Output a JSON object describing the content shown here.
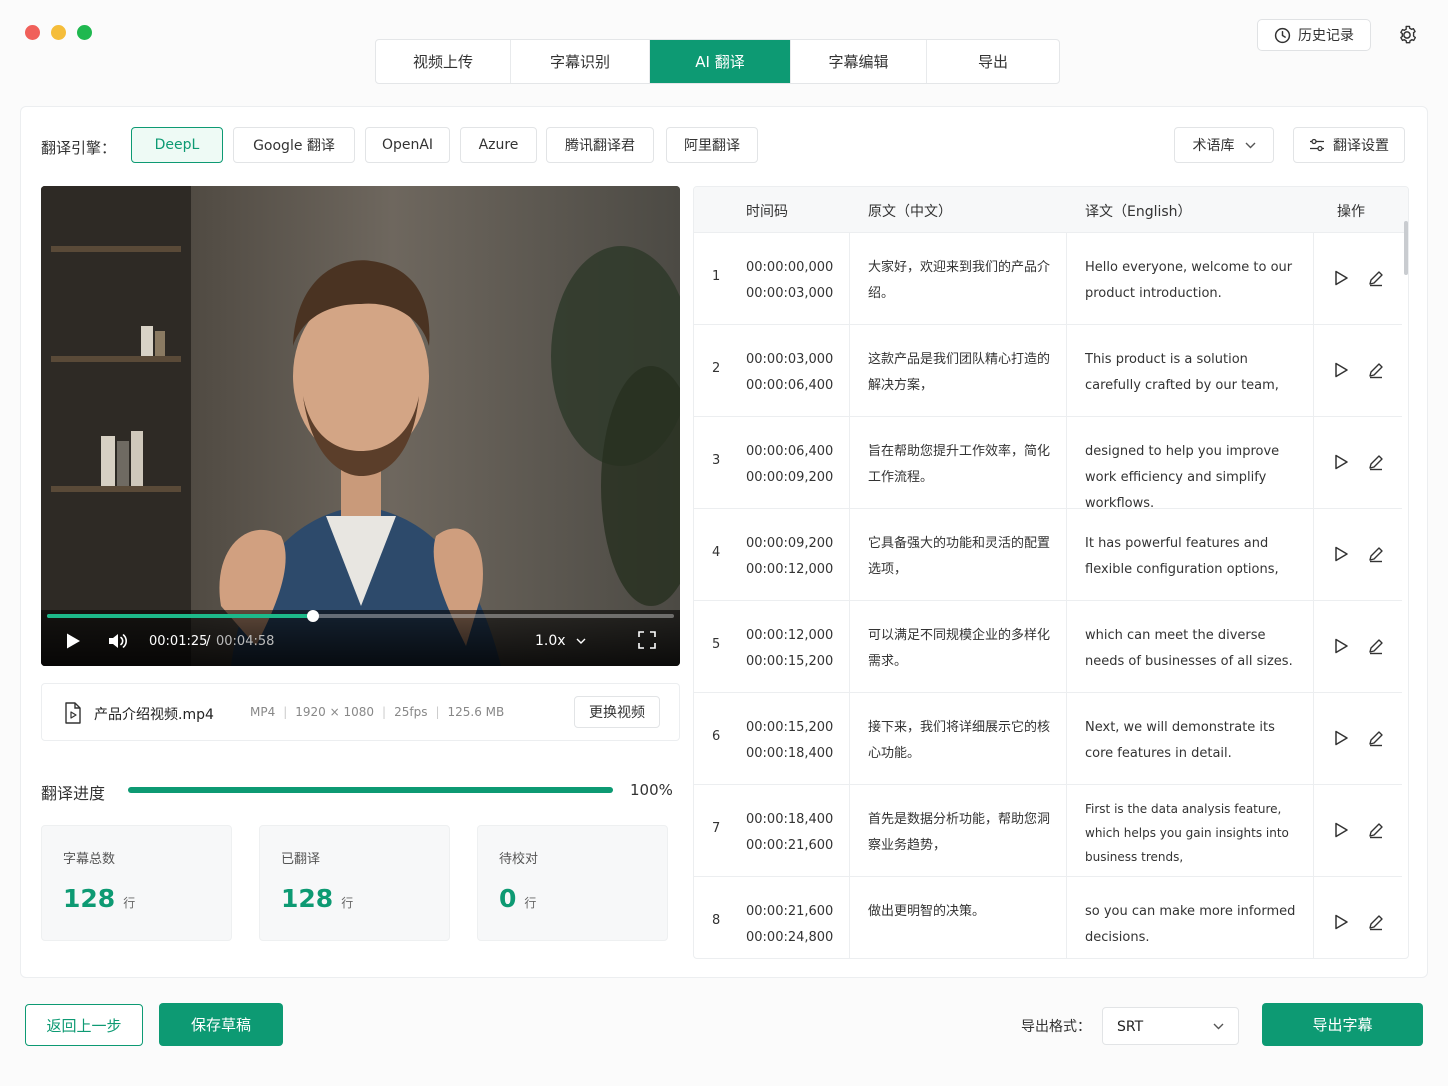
{
  "tabs": [
    "视频上传",
    "字幕识别",
    "AI 翻译",
    "字幕编辑",
    "导出"
  ],
  "active_tab": "AI 翻译",
  "header": {
    "history_label": "历史记录"
  },
  "engine": {
    "label": "翻译引擎：",
    "options": [
      "DeepL",
      "Google 翻译",
      "OpenAI",
      "Azure",
      "腾讯翻译君",
      "阿里翻译"
    ],
    "selected": "DeepL",
    "glossary_label": "术语库",
    "settings_label": "翻译设置"
  },
  "player": {
    "current_time": "00:01:25",
    "separator": "/",
    "total_time": "00:04:58",
    "speed": "1.0x",
    "progress": 0.424
  },
  "file": {
    "name": "产品介绍视频.mp4",
    "format": "MP4",
    "resolution": "1920 × 1080",
    "fps": "25fps",
    "size": "125.6 MB",
    "change_label": "更换视频"
  },
  "progress": {
    "label": "翻译进度",
    "percent_text": "100%",
    "value": 1.0
  },
  "stats": [
    {
      "label": "字幕总数",
      "value": "128",
      "unit": "行"
    },
    {
      "label": "已翻译",
      "value": "128",
      "unit": "行"
    },
    {
      "label": "待校对",
      "value": "0",
      "unit": "行"
    }
  ],
  "table": {
    "headers": {
      "timecode": "时间码",
      "source": "原文（中文）",
      "target": "译文（English）",
      "actions": "操作"
    },
    "rows": [
      {
        "idx": "1",
        "start": "00:00:00,000",
        "end": "00:00:03,000",
        "src": "大家好，欢迎来到我们的产品介绍。",
        "dst": "Hello everyone, welcome to our product introduction."
      },
      {
        "idx": "2",
        "start": "00:00:03,000",
        "end": "00:00:06,400",
        "src": "这款产品是我们团队精心打造的解决方案，",
        "dst": "This product is a solution carefully crafted by our team,"
      },
      {
        "idx": "3",
        "start": "00:00:06,400",
        "end": "00:00:09,200",
        "src": "旨在帮助您提升工作效率，简化工作流程。",
        "dst": "designed to help you improve work efficiency and simplify workflows."
      },
      {
        "idx": "4",
        "start": "00:00:09,200",
        "end": "00:00:12,000",
        "src": "它具备强大的功能和灵活的配置选项，",
        "dst": "It has powerful features and flexible configuration options,"
      },
      {
        "idx": "5",
        "start": "00:00:12,000",
        "end": "00:00:15,200",
        "src": "可以满足不同规模企业的多样化需求。",
        "dst": "which can meet the diverse needs of businesses of all sizes."
      },
      {
        "idx": "6",
        "start": "00:00:15,200",
        "end": "00:00:18,400",
        "src": "接下来，我们将详细展示它的核心功能。",
        "dst": "Next, we will demonstrate its core features in detail."
      },
      {
        "idx": "7",
        "start": "00:00:18,400",
        "end": "00:00:21,600",
        "src": "首先是数据分析功能，帮助您洞察业务趋势，",
        "dst": "First is the data analysis feature, which helps you gain insights into business trends,"
      },
      {
        "idx": "8",
        "start": "00:00:21,600",
        "end": "00:00:24,800",
        "src": "做出更明智的决策。",
        "dst": "so you can make more informed decisions."
      }
    ]
  },
  "footer": {
    "back_label": "返回上一步",
    "save_label": "保存草稿",
    "export_format_label": "导出格式：",
    "export_format": "SRT",
    "export_label": "导出字幕"
  },
  "colors": {
    "accent": "#0d9a73",
    "accent_light": "#eefaf5"
  }
}
